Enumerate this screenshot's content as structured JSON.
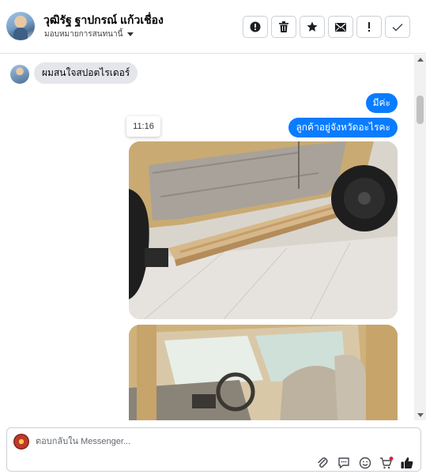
{
  "header": {
    "contact_name": "วุฒิรัฐ ฐาปกรณ์ แก้วเชื่อง",
    "assign_label": "มอบหมายการสนทนานี้",
    "actions": [
      {
        "name": "mark-spam-button",
        "icon": "alert-circle-icon"
      },
      {
        "name": "delete-button",
        "icon": "trash-icon"
      },
      {
        "name": "star-button",
        "icon": "star-icon"
      },
      {
        "name": "mark-unread-button",
        "icon": "envelope-icon"
      },
      {
        "name": "follow-up-button",
        "icon": "exclamation-icon"
      },
      {
        "name": "mark-done-button",
        "icon": "check-icon"
      }
    ]
  },
  "messages": {
    "incoming": [
      {
        "text": "ผมสนใจสปอตไรเดอร์"
      }
    ],
    "outgoing": [
      {
        "text": "มีค่ะ"
      },
      {
        "text": "ลูกค้าอยู่จังหวัดอะไรคะ"
      }
    ],
    "timestamp": "11:16",
    "photos": [
      {
        "subject": "car-side-step-photo"
      },
      {
        "subject": "car-interior-photo"
      }
    ]
  },
  "composer": {
    "placeholder": "ตอบกลับใน Messenger...",
    "tools": [
      "attach-icon",
      "saved-replies-icon",
      "emoji-icon",
      "cart-icon",
      "like-icon"
    ]
  },
  "colors": {
    "outgoing_bubble": "#0a7cff",
    "incoming_bubble": "#e4e6eb",
    "like": "#0a7cff"
  }
}
